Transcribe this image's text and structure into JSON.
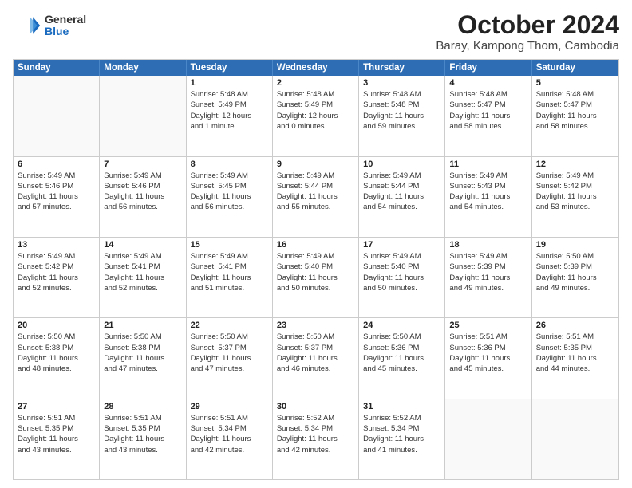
{
  "logo": {
    "general": "General",
    "blue": "Blue"
  },
  "title": "October 2024",
  "location": "Baray, Kampong Thom, Cambodia",
  "header_days": [
    "Sunday",
    "Monday",
    "Tuesday",
    "Wednesday",
    "Thursday",
    "Friday",
    "Saturday"
  ],
  "weeks": [
    [
      {
        "day": "",
        "lines": []
      },
      {
        "day": "",
        "lines": []
      },
      {
        "day": "1",
        "lines": [
          "Sunrise: 5:48 AM",
          "Sunset: 5:49 PM",
          "Daylight: 12 hours",
          "and 1 minute."
        ]
      },
      {
        "day": "2",
        "lines": [
          "Sunrise: 5:48 AM",
          "Sunset: 5:49 PM",
          "Daylight: 12 hours",
          "and 0 minutes."
        ]
      },
      {
        "day": "3",
        "lines": [
          "Sunrise: 5:48 AM",
          "Sunset: 5:48 PM",
          "Daylight: 11 hours",
          "and 59 minutes."
        ]
      },
      {
        "day": "4",
        "lines": [
          "Sunrise: 5:48 AM",
          "Sunset: 5:47 PM",
          "Daylight: 11 hours",
          "and 58 minutes."
        ]
      },
      {
        "day": "5",
        "lines": [
          "Sunrise: 5:48 AM",
          "Sunset: 5:47 PM",
          "Daylight: 11 hours",
          "and 58 minutes."
        ]
      }
    ],
    [
      {
        "day": "6",
        "lines": [
          "Sunrise: 5:49 AM",
          "Sunset: 5:46 PM",
          "Daylight: 11 hours",
          "and 57 minutes."
        ]
      },
      {
        "day": "7",
        "lines": [
          "Sunrise: 5:49 AM",
          "Sunset: 5:46 PM",
          "Daylight: 11 hours",
          "and 56 minutes."
        ]
      },
      {
        "day": "8",
        "lines": [
          "Sunrise: 5:49 AM",
          "Sunset: 5:45 PM",
          "Daylight: 11 hours",
          "and 56 minutes."
        ]
      },
      {
        "day": "9",
        "lines": [
          "Sunrise: 5:49 AM",
          "Sunset: 5:44 PM",
          "Daylight: 11 hours",
          "and 55 minutes."
        ]
      },
      {
        "day": "10",
        "lines": [
          "Sunrise: 5:49 AM",
          "Sunset: 5:44 PM",
          "Daylight: 11 hours",
          "and 54 minutes."
        ]
      },
      {
        "day": "11",
        "lines": [
          "Sunrise: 5:49 AM",
          "Sunset: 5:43 PM",
          "Daylight: 11 hours",
          "and 54 minutes."
        ]
      },
      {
        "day": "12",
        "lines": [
          "Sunrise: 5:49 AM",
          "Sunset: 5:42 PM",
          "Daylight: 11 hours",
          "and 53 minutes."
        ]
      }
    ],
    [
      {
        "day": "13",
        "lines": [
          "Sunrise: 5:49 AM",
          "Sunset: 5:42 PM",
          "Daylight: 11 hours",
          "and 52 minutes."
        ]
      },
      {
        "day": "14",
        "lines": [
          "Sunrise: 5:49 AM",
          "Sunset: 5:41 PM",
          "Daylight: 11 hours",
          "and 52 minutes."
        ]
      },
      {
        "day": "15",
        "lines": [
          "Sunrise: 5:49 AM",
          "Sunset: 5:41 PM",
          "Daylight: 11 hours",
          "and 51 minutes."
        ]
      },
      {
        "day": "16",
        "lines": [
          "Sunrise: 5:49 AM",
          "Sunset: 5:40 PM",
          "Daylight: 11 hours",
          "and 50 minutes."
        ]
      },
      {
        "day": "17",
        "lines": [
          "Sunrise: 5:49 AM",
          "Sunset: 5:40 PM",
          "Daylight: 11 hours",
          "and 50 minutes."
        ]
      },
      {
        "day": "18",
        "lines": [
          "Sunrise: 5:49 AM",
          "Sunset: 5:39 PM",
          "Daylight: 11 hours",
          "and 49 minutes."
        ]
      },
      {
        "day": "19",
        "lines": [
          "Sunrise: 5:50 AM",
          "Sunset: 5:39 PM",
          "Daylight: 11 hours",
          "and 49 minutes."
        ]
      }
    ],
    [
      {
        "day": "20",
        "lines": [
          "Sunrise: 5:50 AM",
          "Sunset: 5:38 PM",
          "Daylight: 11 hours",
          "and 48 minutes."
        ]
      },
      {
        "day": "21",
        "lines": [
          "Sunrise: 5:50 AM",
          "Sunset: 5:38 PM",
          "Daylight: 11 hours",
          "and 47 minutes."
        ]
      },
      {
        "day": "22",
        "lines": [
          "Sunrise: 5:50 AM",
          "Sunset: 5:37 PM",
          "Daylight: 11 hours",
          "and 47 minutes."
        ]
      },
      {
        "day": "23",
        "lines": [
          "Sunrise: 5:50 AM",
          "Sunset: 5:37 PM",
          "Daylight: 11 hours",
          "and 46 minutes."
        ]
      },
      {
        "day": "24",
        "lines": [
          "Sunrise: 5:50 AM",
          "Sunset: 5:36 PM",
          "Daylight: 11 hours",
          "and 45 minutes."
        ]
      },
      {
        "day": "25",
        "lines": [
          "Sunrise: 5:51 AM",
          "Sunset: 5:36 PM",
          "Daylight: 11 hours",
          "and 45 minutes."
        ]
      },
      {
        "day": "26",
        "lines": [
          "Sunrise: 5:51 AM",
          "Sunset: 5:35 PM",
          "Daylight: 11 hours",
          "and 44 minutes."
        ]
      }
    ],
    [
      {
        "day": "27",
        "lines": [
          "Sunrise: 5:51 AM",
          "Sunset: 5:35 PM",
          "Daylight: 11 hours",
          "and 43 minutes."
        ]
      },
      {
        "day": "28",
        "lines": [
          "Sunrise: 5:51 AM",
          "Sunset: 5:35 PM",
          "Daylight: 11 hours",
          "and 43 minutes."
        ]
      },
      {
        "day": "29",
        "lines": [
          "Sunrise: 5:51 AM",
          "Sunset: 5:34 PM",
          "Daylight: 11 hours",
          "and 42 minutes."
        ]
      },
      {
        "day": "30",
        "lines": [
          "Sunrise: 5:52 AM",
          "Sunset: 5:34 PM",
          "Daylight: 11 hours",
          "and 42 minutes."
        ]
      },
      {
        "day": "31",
        "lines": [
          "Sunrise: 5:52 AM",
          "Sunset: 5:34 PM",
          "Daylight: 11 hours",
          "and 41 minutes."
        ]
      },
      {
        "day": "",
        "lines": []
      },
      {
        "day": "",
        "lines": []
      }
    ]
  ]
}
